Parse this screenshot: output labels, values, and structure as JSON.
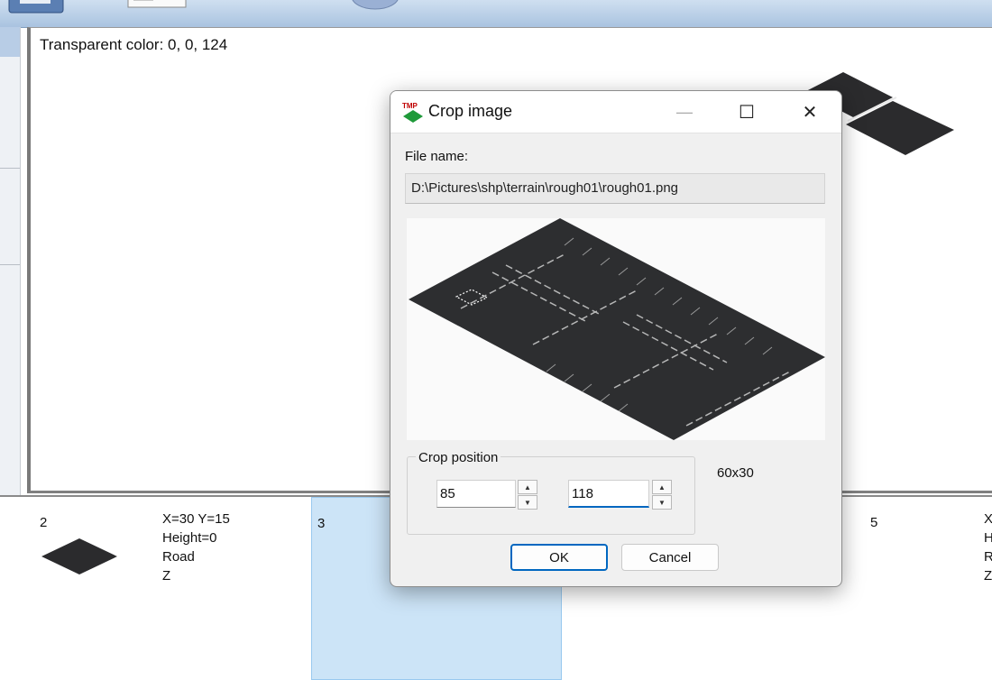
{
  "canvas": {
    "transparent_color_label": "Transparent color: 0, 0, 124"
  },
  "tiles": [
    {
      "number": "2",
      "info": [
        "X=30 Y=15",
        "Height=0",
        "Road",
        "Z"
      ]
    },
    {
      "number": "3"
    },
    {
      "number": "5",
      "info": [
        "X",
        "H",
        "R",
        "Z"
      ]
    }
  ],
  "dialog": {
    "title": "Crop image",
    "app_icon_text": "TMP",
    "file_name_label": "File name:",
    "file_name_value": "D:\\Pictures\\shp\\terrain\\rough01\\rough01.png",
    "crop_group_label": "Crop position",
    "crop_x": "85",
    "crop_y": "118",
    "size_label": "60x30",
    "ok_label": "OK",
    "cancel_label": "Cancel",
    "minimize_glyph": "—",
    "maximize_glyph": "☐",
    "close_glyph": "✕"
  }
}
